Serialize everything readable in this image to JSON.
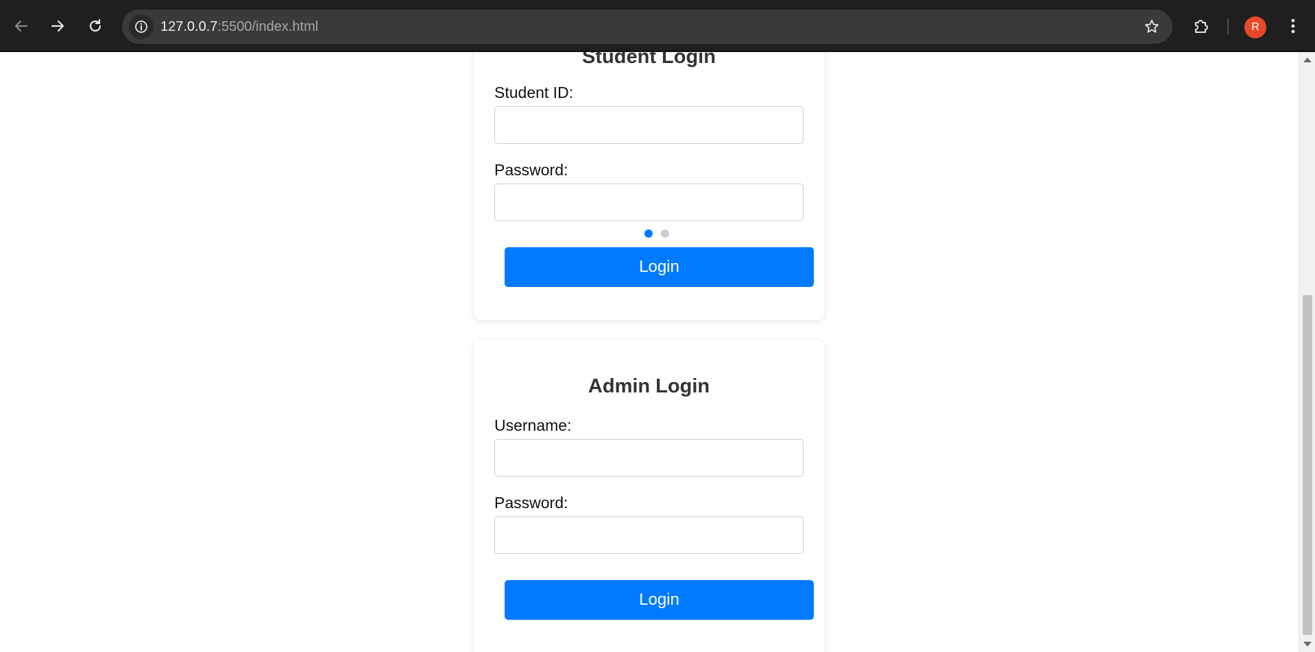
{
  "browser": {
    "url_host": "127.0.0.7",
    "url_rest": ":5500/index.html",
    "profile_initial": "R",
    "icons": {
      "back": "arrow-left-icon",
      "forward": "arrow-right-icon",
      "reload": "reload-icon",
      "site_info": "info-icon",
      "bookmark": "star-icon",
      "extensions": "puzzle-icon",
      "menu": "kebab-menu-icon"
    },
    "colors": {
      "chrome_bg": "#1f1f1f",
      "omnibox_bg": "#3a3a3a",
      "avatar_bg": "#e8492b"
    }
  },
  "student_login": {
    "title": "Student Login",
    "id_label": "Student ID:",
    "id_value": "",
    "password_label": "Password:",
    "password_value": "",
    "carousel_dots": 2,
    "active_dot": 1,
    "button_label": "Login"
  },
  "admin_login": {
    "title": "Admin Login",
    "username_label": "Username:",
    "username_value": "",
    "password_label": "Password:",
    "password_value": "",
    "button_label": "Login"
  },
  "colors": {
    "accent": "#007bff",
    "heading": "#333333",
    "input_border": "#cccccc",
    "dot_inactive": "#cccccc"
  }
}
